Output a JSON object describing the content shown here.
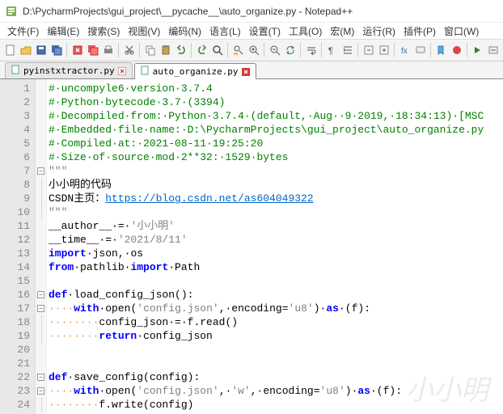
{
  "window": {
    "title": "D:\\PycharmProjects\\gui_project\\__pycache__\\auto_organize.py - Notepad++"
  },
  "menu": {
    "items": [
      "文件(F)",
      "编辑(E)",
      "搜索(S)",
      "视图(V)",
      "编码(N)",
      "语言(L)",
      "设置(T)",
      "工具(O)",
      "宏(M)",
      "运行(R)",
      "插件(P)",
      "窗口(W)"
    ]
  },
  "toolbar": {
    "buttons": [
      "new",
      "open",
      "save",
      "save-all",
      "close",
      "close-all",
      "print",
      "cut",
      "copy",
      "paste",
      "undo",
      "redo",
      "find",
      "replace",
      "zoom-in",
      "zoom-out",
      "sync",
      "wrap",
      "ws",
      "indent",
      "fold",
      "unfold",
      "func",
      "comment",
      "bookmark",
      "record",
      "play",
      "macro"
    ]
  },
  "tabs": {
    "items": [
      {
        "label": "pyinstxtractor.py",
        "active": false,
        "dirty": false
      },
      {
        "label": "auto_organize.py",
        "active": true,
        "dirty": true
      }
    ]
  },
  "code": {
    "lines": [
      {
        "n": 1,
        "fold": "",
        "segs": [
          [
            "cmt",
            "#·uncompyle6·version·3.7.4"
          ]
        ]
      },
      {
        "n": 2,
        "fold": "",
        "segs": [
          [
            "cmt",
            "#·Python·bytecode·3.7·(3394)"
          ]
        ]
      },
      {
        "n": 3,
        "fold": "",
        "segs": [
          [
            "cmt",
            "#·Decompiled·from:·Python·3.7.4·(default,·Aug··9·2019,·18:34:13)·[MSC"
          ]
        ]
      },
      {
        "n": 4,
        "fold": "",
        "segs": [
          [
            "cmt",
            "#·Embedded·file·name:·D:\\PycharmProjects\\gui_project\\auto_organize.py"
          ]
        ]
      },
      {
        "n": 5,
        "fold": "",
        "segs": [
          [
            "cmt",
            "#·Compiled·at:·2021-08-11·19:25:20"
          ]
        ]
      },
      {
        "n": 6,
        "fold": "",
        "segs": [
          [
            "cmt",
            "#·Size·of·source·mod·2**32:·1529·bytes"
          ]
        ]
      },
      {
        "n": 7,
        "fold": "box",
        "segs": [
          [
            "str",
            "\"\"\""
          ]
        ]
      },
      {
        "n": 8,
        "fold": "vline",
        "segs": [
          [
            "doc",
            "小小明的代码"
          ]
        ]
      },
      {
        "n": 9,
        "fold": "vline",
        "segs": [
          [
            "doc",
            "CSDN主页："
          ],
          [
            "lnk",
            "https://blog.csdn.net/as604049322"
          ]
        ]
      },
      {
        "n": 10,
        "fold": "vline",
        "segs": [
          [
            "str",
            "\"\"\""
          ]
        ]
      },
      {
        "n": 11,
        "fold": "",
        "segs": [
          [
            "op",
            "__author__·"
          ],
          [
            "op",
            "=·"
          ],
          [
            "str2",
            "'小小明'"
          ]
        ]
      },
      {
        "n": 12,
        "fold": "",
        "segs": [
          [
            "op",
            "__time__·"
          ],
          [
            "op",
            "=·"
          ],
          [
            "str2",
            "'2021/8/11'"
          ]
        ]
      },
      {
        "n": 13,
        "fold": "",
        "segs": [
          [
            "kw",
            "import"
          ],
          [
            "op",
            "·json"
          ],
          [
            "op",
            ",·"
          ],
          [
            "op",
            "os"
          ]
        ]
      },
      {
        "n": 14,
        "fold": "",
        "segs": [
          [
            "kw",
            "from"
          ],
          [
            "op",
            "·pathlib·"
          ],
          [
            "kw",
            "import"
          ],
          [
            "op",
            "·Path"
          ]
        ]
      },
      {
        "n": 15,
        "fold": "",
        "segs": []
      },
      {
        "n": 16,
        "fold": "box",
        "segs": [
          [
            "kw",
            "def"
          ],
          [
            "op",
            "·"
          ],
          [
            "fn",
            "load_config_json"
          ],
          [
            "op",
            "()"
          ],
          [
            "op",
            ":"
          ]
        ]
      },
      {
        "n": 17,
        "fold": "box",
        "segs": [
          [
            "ws",
            "····"
          ],
          [
            "kw",
            "with"
          ],
          [
            "op",
            "·"
          ],
          [
            "fn",
            "open"
          ],
          [
            "op",
            "("
          ],
          [
            "str2",
            "'config.json'"
          ],
          [
            "op",
            ",·encoding="
          ],
          [
            "str2",
            "'u8'"
          ],
          [
            "op",
            ")·"
          ],
          [
            "kw",
            "as"
          ],
          [
            "op",
            "·(f)"
          ],
          [
            "op",
            ":"
          ]
        ]
      },
      {
        "n": 18,
        "fold": "vline",
        "segs": [
          [
            "ws",
            "········"
          ],
          [
            "op",
            "config_json·=·f.read()"
          ]
        ]
      },
      {
        "n": 19,
        "fold": "vline",
        "segs": [
          [
            "ws",
            "········"
          ],
          [
            "kw",
            "return"
          ],
          [
            "op",
            "·config_json"
          ]
        ]
      },
      {
        "n": 20,
        "fold": "",
        "segs": []
      },
      {
        "n": 21,
        "fold": "",
        "segs": []
      },
      {
        "n": 22,
        "fold": "box",
        "segs": [
          [
            "kw",
            "def"
          ],
          [
            "op",
            "·"
          ],
          [
            "fn",
            "save_config"
          ],
          [
            "op",
            "(config)"
          ],
          [
            "op",
            ":"
          ]
        ]
      },
      {
        "n": 23,
        "fold": "box",
        "segs": [
          [
            "ws",
            "····"
          ],
          [
            "kw",
            "with"
          ],
          [
            "op",
            "·"
          ],
          [
            "fn",
            "open"
          ],
          [
            "op",
            "("
          ],
          [
            "str2",
            "'config.json'"
          ],
          [
            "op",
            ",·"
          ],
          [
            "str2",
            "'w'"
          ],
          [
            "op",
            ",·encoding="
          ],
          [
            "str2",
            "'u8'"
          ],
          [
            "op",
            ")·"
          ],
          [
            "kw",
            "as"
          ],
          [
            "op",
            "·(f)"
          ],
          [
            "op",
            ":"
          ]
        ]
      },
      {
        "n": 24,
        "fold": "vline",
        "segs": [
          [
            "ws",
            "········"
          ],
          [
            "op",
            "f.write(config)"
          ]
        ]
      }
    ]
  },
  "watermark": "小小明"
}
